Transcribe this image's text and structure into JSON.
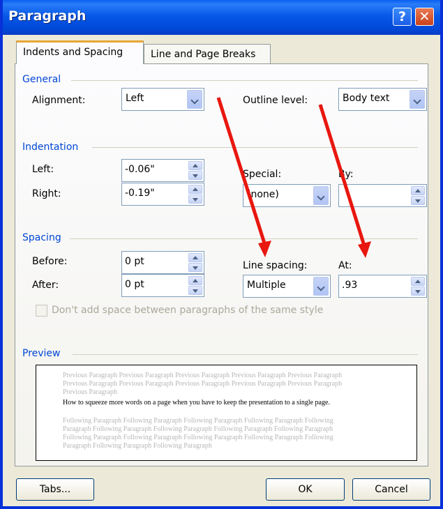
{
  "window": {
    "title": "Paragraph",
    "help_glyph": "?",
    "close_glyph": "✕"
  },
  "tabs": [
    {
      "label": "Indents and Spacing"
    },
    {
      "label": "Line and Page Breaks"
    }
  ],
  "general": {
    "section_label": "General",
    "alignment_label": "Alignment:",
    "alignment_value": "Left",
    "outline_label": "Outline level:",
    "outline_value": "Body text"
  },
  "indentation": {
    "section_label": "Indentation",
    "left_label": "Left:",
    "left_value": "-0.06\"",
    "right_label": "Right:",
    "right_value": "-0.19\"",
    "special_label": "Special:",
    "special_value": "(none)",
    "by_label": "By:",
    "by_value": ""
  },
  "spacing": {
    "section_label": "Spacing",
    "before_label": "Before:",
    "before_value": "0 pt",
    "after_label": "After:",
    "after_value": "0 pt",
    "line_spacing_label": "Line spacing:",
    "line_spacing_value": "Multiple",
    "at_label": "At:",
    "at_value": ".93",
    "dont_add_space_label": "Don't add space between paragraphs of the same style"
  },
  "preview": {
    "section_label": "Preview",
    "previous_text": "Previous Paragraph Previous Paragraph Previous Paragraph Previous Paragraph Previous Paragraph Previous Paragraph Previous Paragraph Previous Paragraph Previous Paragraph Previous Paragraph Previous Paragraph",
    "current_text": "How to squeeze more words on a page when you have to keep the presentation to a single page.",
    "following_text": "Following Paragraph Following Paragraph Following Paragraph Following Paragraph Following Paragraph Following Paragraph Following Paragraph Following Paragraph Following Paragraph Following Paragraph Following Paragraph Following Paragraph Following Paragraph Following Paragraph Following Paragraph Following Paragraph"
  },
  "buttons": {
    "tabs": "Tabs...",
    "ok": "OK",
    "cancel": "Cancel"
  },
  "annotation": {
    "arrow_color": "#e8170f"
  }
}
